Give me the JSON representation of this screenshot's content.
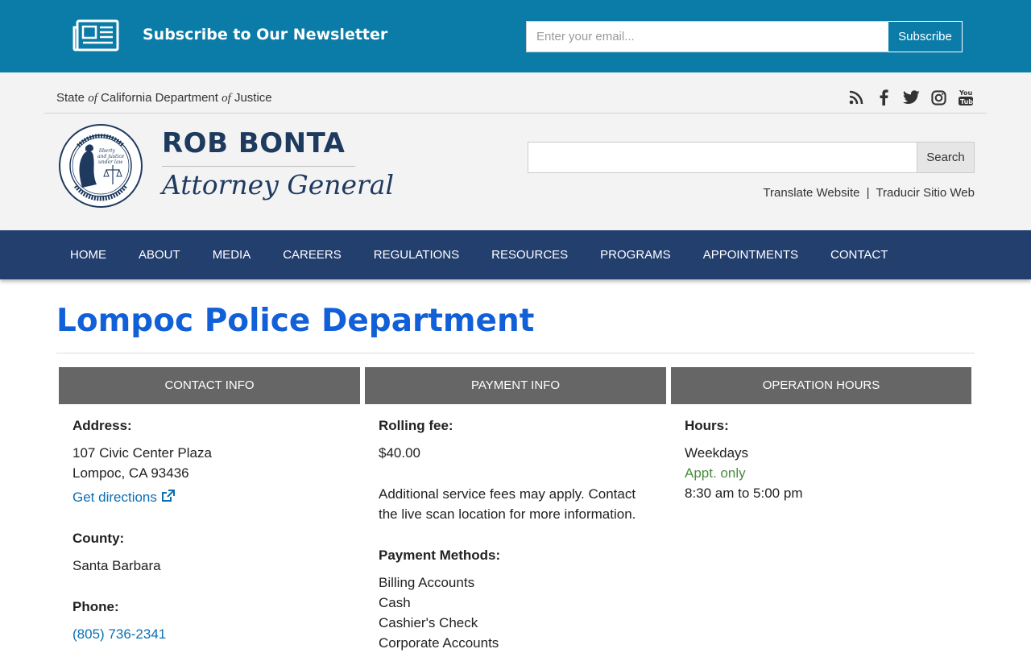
{
  "newsletter": {
    "title": "Subscribe to Our Newsletter",
    "email_placeholder": "Enter your email...",
    "subscribe_label": "Subscribe"
  },
  "header": {
    "state_prefix": "State",
    "state_of1": "of",
    "state_mid": "California Department",
    "state_of2": "of",
    "state_suffix": "Justice",
    "ag_name": "ROB BONTA",
    "ag_title": "Attorney General",
    "search_label": "Search",
    "translate_en": "Translate Website",
    "translate_sep": "|",
    "translate_es": "Traducir Sitio Web",
    "social_icons": [
      "rss-icon",
      "facebook-icon",
      "twitter-icon",
      "instagram-icon",
      "youtube-icon"
    ]
  },
  "nav": {
    "items": [
      "HOME",
      "ABOUT",
      "MEDIA",
      "CAREERS",
      "REGULATIONS",
      "RESOURCES",
      "PROGRAMS",
      "APPOINTMENTS",
      "CONTACT"
    ]
  },
  "page": {
    "title": "Lompoc Police Department"
  },
  "columns": {
    "contact_head": "CONTACT INFO",
    "payment_head": "PAYMENT INFO",
    "hours_head": "OPERATION HOURS"
  },
  "contact": {
    "address_label": "Address:",
    "address_line1": "107 Civic Center Plaza",
    "address_line2": "Lompoc, CA 93436",
    "directions": "Get directions",
    "county_label": "County:",
    "county": "Santa Barbara",
    "phone_label": "Phone:",
    "phone": "(805) 736-2341"
  },
  "payment": {
    "rolling_label": "Rolling fee:",
    "rolling_fee": "$40.00",
    "fee_note_1": "Additional service fees may apply. Contact",
    "fee_note_2": "the live scan location for more information.",
    "methods_label": "Payment Methods:",
    "methods": [
      "Billing Accounts",
      "Cash",
      "Cashier's Check",
      "Corporate Accounts"
    ]
  },
  "hours": {
    "hours_label": "Hours:",
    "days": "Weekdays",
    "appt": "Appt. only",
    "time": "8:30 am to 5:00 pm"
  },
  "colors": {
    "newsletter_bg": "#0b7ca8",
    "nav_bg": "#233f6e",
    "title": "#1160d8",
    "link": "#0b6fb3",
    "appt_green": "#4a8c3f"
  }
}
